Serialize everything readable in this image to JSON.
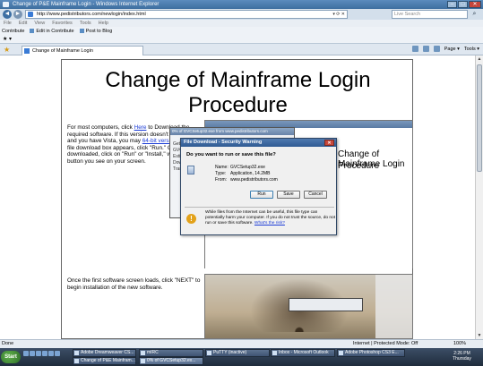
{
  "window": {
    "title": "Change of P&E Mainframe Login - Windows Internet Explorer",
    "controls": [
      "–",
      "□",
      "✕"
    ]
  },
  "address_bar": {
    "back": "◄",
    "forward": "►",
    "url": "http://www.pedistributors.com/newlogin/index.html",
    "url_controls": "▾ ⟳ ✕",
    "search_placeholder": "Live Search",
    "search_icon": "search-icon"
  },
  "menu": [
    "File",
    "Edit",
    "View",
    "Favorites",
    "Tools",
    "Help"
  ],
  "links_bar": [
    "Contribute",
    "Edit in Contribute",
    "Post to Blog"
  ],
  "favorites_bar": {
    "icons": "★ ▾"
  },
  "tab_row": {
    "tab_label": "Change of Mainframe Login",
    "tools": [
      "Page ▾",
      "Tools ▾"
    ]
  },
  "page": {
    "heading": "Change of Mainframe Login Procedure",
    "p1_before": "For most computers, click ",
    "p1_link": "Here",
    "p1_mid": " to Download the required software. If this version doesn't work for you, and you have Vista, you may ",
    "p1_link2": "64-bit version",
    "p1_after": ". When the file download box appears, click \"Run.\" Once the file is downloaded, click on \"Run\" or \"Install,\" whichever button you see on your screen.",
    "p2": "Once the first software screen loads, click \"NEXT\" to begin installation of the new software.",
    "shot_text_1": "Change of Mainframe Login",
    "shot_text_2": "Procedure"
  },
  "background_dialog": {
    "title": "0% of GVCSetup32.exe from www.pedistributors.com",
    "lines": [
      "Getting",
      "GVCSetup32.exe from www.pedistributors.com",
      "Estimated time left",
      "Download to:",
      "Transfer rate:"
    ]
  },
  "dialog": {
    "title": "File Download - Security Warning",
    "close": "✕",
    "question": "Do you want to run or save this file?",
    "file_icon": "exe-file-icon",
    "name_label": "Name:",
    "name_value": "GVCSetup32.exe",
    "type_label": "Type:",
    "type_value": "Application, 14.2MB",
    "from_label": "From:",
    "from_value": "www.pedistributors.com",
    "run": "Run",
    "save": "Save",
    "cancel": "Cancel",
    "warning_icon": "shield-warning-icon",
    "warning_text": "While files from the Internet can be useful, this file type can potentially harm your computer. If you do not trust the source, do not run or save this software. ",
    "warning_link": "What's the risk?"
  },
  "status_bar": {
    "left": "Done",
    "zone": "Internet | Protected Mode: Off",
    "zoom": "100%"
  },
  "taskbar": {
    "start": "Start",
    "row1": [
      "Adobe Dreamweaver CS...",
      "mIRC",
      "PuTTY (inactive)",
      "Inbox - Microsoft Outlook",
      "Adobe Photoshop CS3 E..."
    ],
    "row2": [
      "Change of P&E Mainfram...",
      "0% of GVCSetup32.ex..."
    ],
    "time": "2:26 PM",
    "day": "Thursday"
  }
}
